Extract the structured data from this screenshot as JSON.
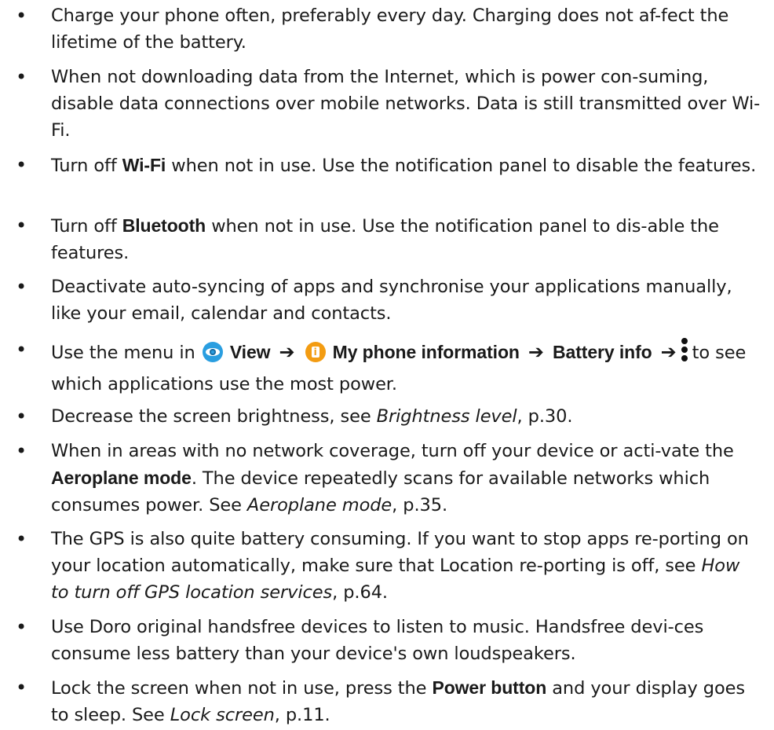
{
  "items": [
    {
      "text": "Charge your phone often, preferably every day. Charging does not af-fect the lifetime of the battery."
    },
    {
      "text": "When not downloading data from the Internet, which is power con-suming, disable data connections over mobile networks. Data is still transmitted over Wi-Fi."
    },
    {
      "pre": "Turn off ",
      "bold": "Wi-Fi",
      "post": " when not in use. Use the notification panel to disable the features."
    },
    {
      "pre": "Turn off ",
      "bold": "Bluetooth",
      "post": " when not in use. Use the notification panel to dis-able the features."
    },
    {
      "text": "Deactivate auto-syncing of apps and synchronise your applications manually, like your email, calendar and contacts."
    },
    {
      "pre": "Use the menu in ",
      "view_label": "View",
      "view_icon": "eye-icon",
      "arrow": "➔",
      "info_label": "My phone information",
      "info_icon": "info-icon",
      "battery_label": "Battery info",
      "more_icon": "more-vertical-icon",
      "post": "to see which applications use the most power."
    },
    {
      "pre": "Decrease the screen brightness, see ",
      "italic": "Brightness level",
      "post": ", p.30."
    },
    {
      "pre": "When in areas with no network coverage, turn off your device or acti-vate the ",
      "bold": "Aeroplane mode",
      "mid": ". The device repeatedly scans for available networks which consumes power. See ",
      "italic": "Aeroplane mode",
      "post": ", p.35."
    },
    {
      "pre": "The GPS is also quite battery consuming. If you want to stop apps re-porting on your location automatically, make sure that Location re-porting is off, see ",
      "italic": "How to turn off GPS location services",
      "post": ", p.64."
    },
    {
      "text": "Use Doro original handsfree devices to listen to music. Handsfree devi-ces consume less battery than your device's own loudspeakers."
    },
    {
      "pre": "Lock the screen when not in use, press the ",
      "bold": "Power button",
      "mid": " and your display goes to sleep. See ",
      "italic": "Lock screen",
      "post": ", p.11."
    }
  ],
  "bullet": "•"
}
